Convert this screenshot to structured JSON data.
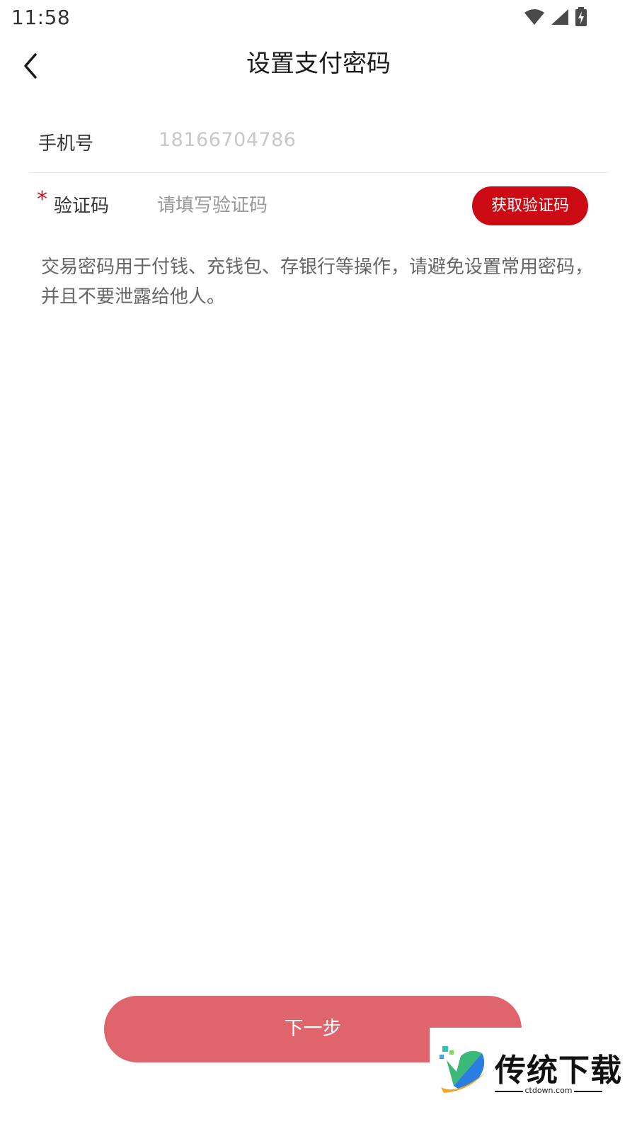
{
  "status_bar": {
    "time": "11:58"
  },
  "header": {
    "title": "设置支付密码"
  },
  "form": {
    "phone": {
      "label": "手机号",
      "value": "18166704786"
    },
    "code": {
      "required_mark": "*",
      "label": "验证码",
      "placeholder": "请填写验证码",
      "button_label": "获取验证码"
    }
  },
  "notice_text": "交易密码用于付钱、充钱包、存银行等操作，请避免设置常用密码，并且不要泄露给他人。",
  "next_button_label": "下一步",
  "watermark": {
    "title": "传统下载",
    "domain": "ctdown.com"
  },
  "colors": {
    "accent": "#cc0a14",
    "next_button": "#e0646c"
  },
  "icons": [
    "wifi-icon",
    "signal-icon",
    "battery-icon",
    "back-arrow-icon"
  ]
}
